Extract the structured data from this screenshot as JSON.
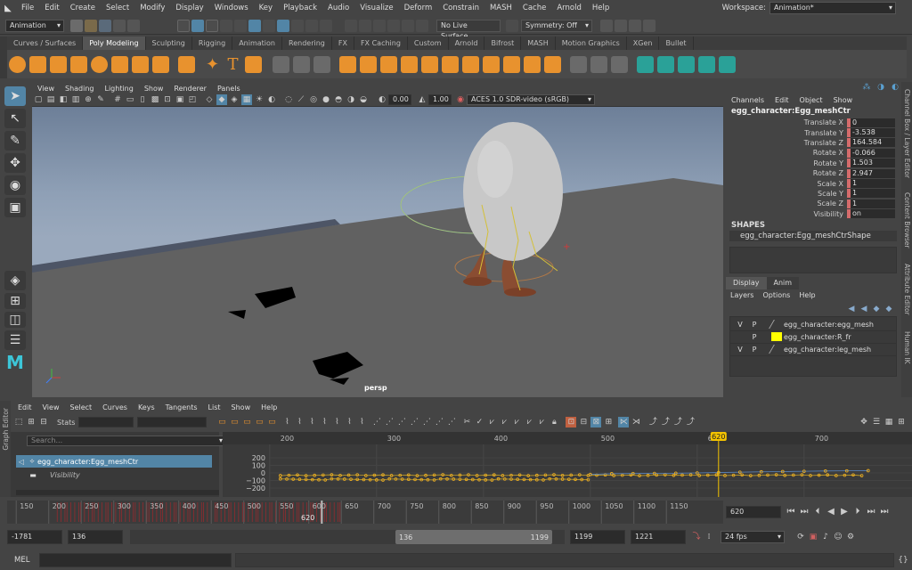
{
  "menubar": {
    "items": [
      "File",
      "Edit",
      "Create",
      "Select",
      "Modify",
      "Display",
      "Windows",
      "Key",
      "Playback",
      "Audio",
      "Visualize",
      "Deform",
      "Constrain",
      "MASH",
      "Cache",
      "Arnold",
      "Help"
    ],
    "workspace_label": "Workspace:",
    "workspace_value": "Animation*"
  },
  "statusline": {
    "mode": "Animation",
    "live_surface": "No Live Surface",
    "symmetry": "Symmetry: Off"
  },
  "shelf": {
    "tabs": [
      "Curves / Surfaces",
      "Poly Modeling",
      "Sculpting",
      "Rigging",
      "Animation",
      "Rendering",
      "FX",
      "FX Caching",
      "Custom",
      "Arnold",
      "Bifrost",
      "MASH",
      "Motion Graphics",
      "XGen",
      "Bullet"
    ],
    "active_tab": 1
  },
  "viewport": {
    "menu": [
      "View",
      "Shading",
      "Lighting",
      "Show",
      "Renderer",
      "Panels"
    ],
    "exposure": "0.00",
    "gamma": "1.00",
    "color_space": "ACES 1.0 SDR-video (sRGB)",
    "camera_label": "persp"
  },
  "channelbox": {
    "menu": [
      "Channels",
      "Edit",
      "Object",
      "Show"
    ],
    "object_name": "egg_character:Egg_meshCtr",
    "channels": [
      {
        "name": "Translate X",
        "value": "0"
      },
      {
        "name": "Translate Y",
        "value": "-3.538"
      },
      {
        "name": "Translate Z",
        "value": "164.584"
      },
      {
        "name": "Rotate X",
        "value": "-0.066"
      },
      {
        "name": "Rotate Y",
        "value": "1.503"
      },
      {
        "name": "Rotate Z",
        "value": "2.947"
      },
      {
        "name": "Scale X",
        "value": "1"
      },
      {
        "name": "Scale Y",
        "value": "1"
      },
      {
        "name": "Scale Z",
        "value": "1"
      },
      {
        "name": "Visibility",
        "value": "on"
      }
    ],
    "shapes_header": "SHAPES",
    "shape_name": "egg_character:Egg_meshCtrShape"
  },
  "layereditor": {
    "tabs": [
      "Display",
      "Anim"
    ],
    "menu": [
      "Layers",
      "Options",
      "Help"
    ],
    "layers": [
      {
        "v": "V",
        "p": "P",
        "name": "egg_character:egg_mesh",
        "color": ""
      },
      {
        "v": "",
        "p": "P",
        "name": "egg_character:R_fr",
        "color": "#ffff00"
      },
      {
        "v": "V",
        "p": "P",
        "name": "egg_character:leg_mesh",
        "color": ""
      }
    ]
  },
  "rightstrip": {
    "labels": [
      "Channel Box / Layer Editor",
      "Content Browser",
      "Attribute Editor",
      "Human IK"
    ]
  },
  "grapheditor": {
    "side_label": "Graph Editor",
    "menu": [
      "Edit",
      "View",
      "Select",
      "Curves",
      "Keys",
      "Tangents",
      "List",
      "Show",
      "Help"
    ],
    "stats_label": "Stats",
    "search_placeholder": "Search...",
    "outliner_items": [
      "egg_character:Egg_meshCtr",
      "Visibility"
    ],
    "ruler": [
      "200",
      "300",
      "400",
      "500",
      "600",
      "700"
    ],
    "current_frame": "620",
    "y_labels": [
      "200",
      "100",
      "0",
      "−100",
      "−200"
    ]
  },
  "timeslider": {
    "ticks": [
      "150",
      "200",
      "250",
      "300",
      "350",
      "400",
      "450",
      "500",
      "550",
      "600",
      "650",
      "700",
      "750",
      "800",
      "850",
      "900",
      "950",
      "1000",
      "1050",
      "1100",
      "1150"
    ],
    "current_frame": "620",
    "current_field": "620"
  },
  "rangebar": {
    "start": "-1781",
    "anim_start": "136",
    "range_start": "136",
    "range_end": "1199",
    "anim_end": "1199",
    "end": "1221",
    "fps": "24 fps"
  },
  "cmdline": {
    "label": "MEL"
  },
  "colors": {
    "accent": "#5285a6",
    "shelf_orange": "#e8922e",
    "playhead": "#f5c400"
  }
}
